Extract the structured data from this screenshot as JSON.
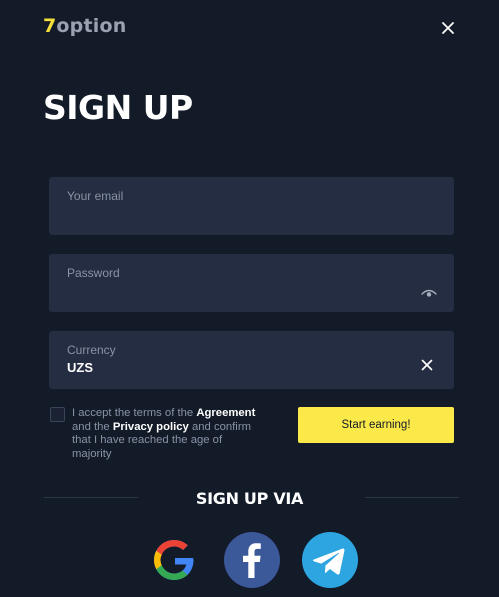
{
  "brand": {
    "logo_seven": "7",
    "logo_rest": "option"
  },
  "header": {
    "title": "SIGN UP"
  },
  "form": {
    "email": {
      "label": "Your email",
      "value": ""
    },
    "password": {
      "label": "Password",
      "value": ""
    },
    "currency": {
      "label": "Currency",
      "value": "UZS"
    }
  },
  "terms": {
    "part1": "I accept the terms of the ",
    "agreement": "Agreement",
    "part2": " and the ",
    "privacy": "Privacy policy",
    "part3": " and confirm that I have reached the age of majority"
  },
  "actions": {
    "start_label": "Start earning!"
  },
  "social": {
    "heading": "SIGN UP VIA",
    "providers": [
      "Google",
      "Facebook",
      "Telegram"
    ]
  },
  "colors": {
    "background": "#131a28",
    "field": "#242d42",
    "accent": "#fbe94a",
    "facebook": "#3b5998",
    "telegram": "#2ca5e0"
  },
  "icons": {
    "close": "close-icon",
    "password_toggle": "eye-icon",
    "currency_clear": "close-icon",
    "providers": [
      "google-icon",
      "facebook-icon",
      "telegram-icon"
    ]
  }
}
